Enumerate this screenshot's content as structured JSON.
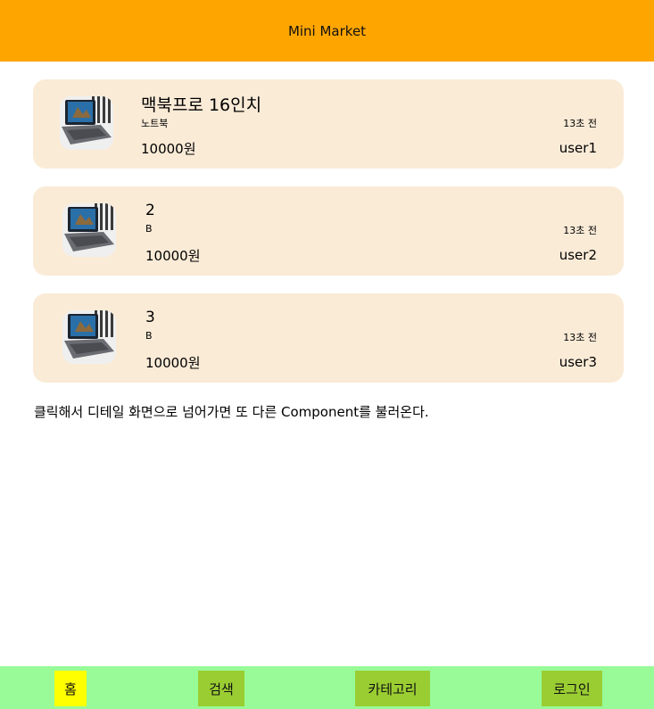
{
  "header": {
    "title": "Mini Market"
  },
  "products": [
    {
      "title": "맥북프로 16인치",
      "category": "노트북",
      "price": "10000원",
      "time": "13초 전",
      "user": "user1"
    },
    {
      "title": "2",
      "category": "B",
      "price": "10000원",
      "time": "13초 전",
      "user": "user2"
    },
    {
      "title": "3",
      "category": "B",
      "price": "10000원",
      "time": "13초 전",
      "user": "user3"
    }
  ],
  "note": "클릭해서 디테일 화면으로 넘어가면 또 다른 Component를 불러온다.",
  "nav": {
    "home": "홈",
    "search": "검색",
    "category": "카테고리",
    "login": "로그인"
  },
  "colors": {
    "header": "#ffa500",
    "card": "#faebd7",
    "nav_bar": "#98fb98",
    "nav_active": "#ffff00",
    "nav_button": "#9acd32"
  },
  "icons": [
    "laptop-image"
  ]
}
